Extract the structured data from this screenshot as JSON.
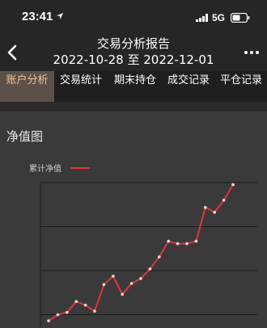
{
  "status_bar": {
    "time": "23:41",
    "network": "5G",
    "icons": [
      "location-arrow-icon",
      "signal-bars-icon",
      "battery-icon"
    ]
  },
  "nav": {
    "title": "交易分析报告",
    "date_range": "2022-10-28 至 2022-12-01",
    "back_icon": "chevron-left-icon",
    "more_icon": "more-dots-icon"
  },
  "tabs": [
    {
      "label": "账户分析",
      "active": true
    },
    {
      "label": "交易统计",
      "active": false
    },
    {
      "label": "期末持仓",
      "active": false
    },
    {
      "label": "成交记录",
      "active": false
    },
    {
      "label": "平仓记录",
      "active": false
    }
  ],
  "colors": {
    "accent": "#f1c39a",
    "active_tab_bg": "#5b5149",
    "line": "#e0353f",
    "background": "#3a3a3a"
  },
  "net_value_section": {
    "title": "净值图"
  },
  "chart_data": {
    "type": "line",
    "title": "",
    "xlabel": "",
    "ylabel": "",
    "grid": true,
    "legend_position": "top-left",
    "series": [
      {
        "name": "累计净值",
        "color": "#e0353f",
        "x": [
          0,
          1,
          2,
          3,
          4,
          5,
          6,
          7,
          8,
          9,
          10,
          11,
          12,
          13,
          14,
          15,
          16,
          17,
          18,
          19,
          20
        ],
        "values": [
          0.0,
          0.5,
          0.7,
          1.6,
          1.3,
          0.8,
          3.0,
          3.7,
          2.2,
          3.1,
          3.5,
          4.3,
          5.3,
          6.6,
          6.4,
          6.4,
          6.6,
          9.4,
          9.0,
          10.0,
          11.3
        ]
      }
    ],
    "ylim": [
      -1,
      12
    ]
  }
}
